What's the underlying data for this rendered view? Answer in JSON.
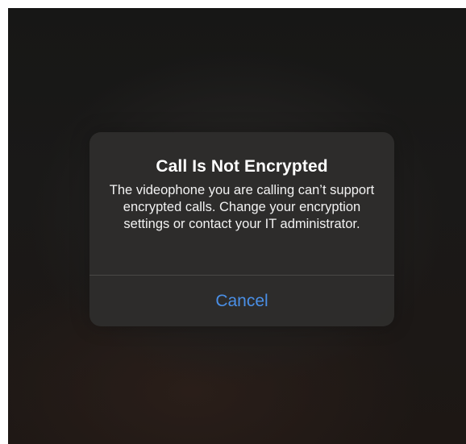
{
  "dialog": {
    "title": "Call Is Not Encrypted",
    "message": "The videophone you are calling can’t support encrypted calls. Change your encryption settings or contact your IT administrator.",
    "cancel_label": "Cancel"
  },
  "colors": {
    "accent": "#4a8fe6",
    "dialog_background": "#2e2d2c",
    "title_text": "#ffffff"
  }
}
